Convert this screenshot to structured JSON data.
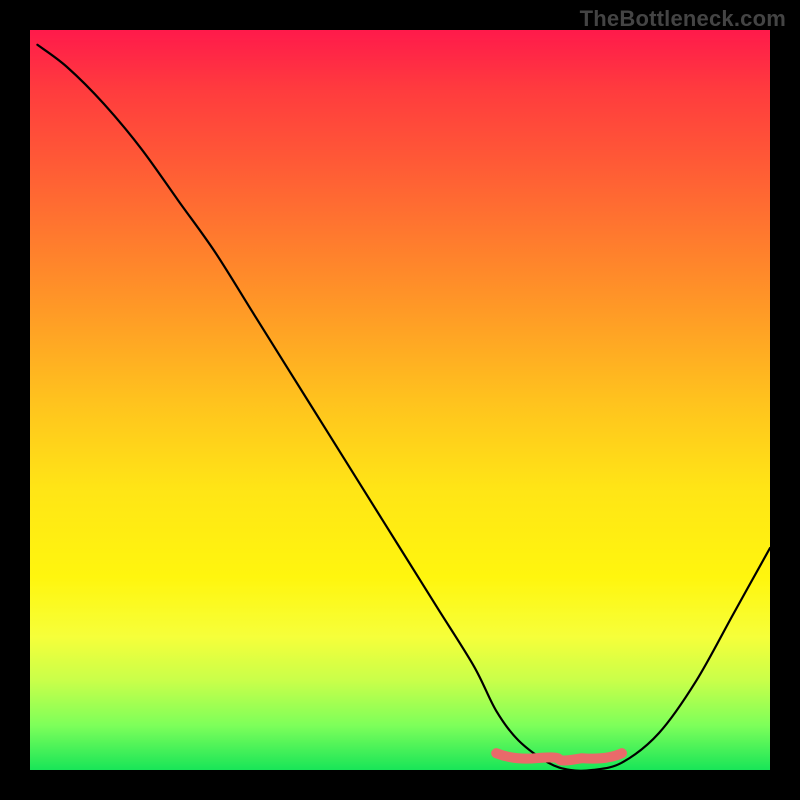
{
  "watermark": "TheBottleneck.com",
  "chart_data": {
    "type": "line",
    "title": "",
    "xlabel": "",
    "ylabel": "",
    "xlim": [
      0,
      100
    ],
    "ylim": [
      0,
      100
    ],
    "grid": false,
    "series": [
      {
        "name": "bottleneck-curve",
        "x": [
          1,
          5,
          10,
          15,
          20,
          25,
          30,
          35,
          40,
          45,
          50,
          55,
          60,
          63,
          66,
          70,
          73,
          76,
          80,
          85,
          90,
          95,
          100
        ],
        "y": [
          98,
          95,
          90,
          84,
          77,
          70,
          62,
          54,
          46,
          38,
          30,
          22,
          14,
          8,
          4,
          1,
          0,
          0,
          1,
          5,
          12,
          21,
          30
        ]
      }
    ],
    "overlay_segment": {
      "name": "optimal-range",
      "color": "#e96a6a",
      "x": [
        63,
        80
      ],
      "y": [
        2,
        2
      ]
    },
    "gradient_stops": [
      {
        "pos": 0.0,
        "color": "#ff1a4b"
      },
      {
        "pos": 0.5,
        "color": "#ffc21e"
      },
      {
        "pos": 0.82,
        "color": "#f6ff3a"
      },
      {
        "pos": 1.0,
        "color": "#18e558"
      }
    ]
  }
}
